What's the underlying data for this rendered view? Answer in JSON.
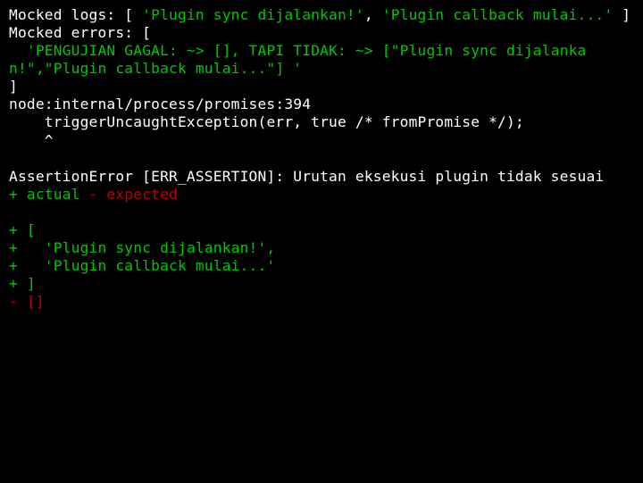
{
  "line1a": "Mocked logs: [ ",
  "line1b": "'Plugin sync dijalankan!'",
  "line1c": ", ",
  "line1d": "'Plugin callback mulai...'",
  "line1e": " ]",
  "line2": "Mocked errors: [",
  "line3": "  'PENGUJIAN GAGAL: ~> [], TAPI TIDAK: ~> [\"Plugin sync dijalankan!\",\"Plugin callback mulai...\"] '",
  "line4": "]",
  "line5": "node:internal/process/promises:394",
  "line6": "    triggerUncaughtException(err, true /* fromPromise */);",
  "line7": "    ^",
  "line8": "",
  "line9": "AssertionError [ERR_ASSERTION]: Urutan eksekusi plugin tidak sesuai",
  "line10a": "+ actual",
  "line10b": " ",
  "line10c": "- expected",
  "line11": "",
  "line12": "+ [",
  "line13": "+   'Plugin sync dijalankan!',",
  "line14": "+   'Plugin callback mulai...'",
  "line15": "+ ]",
  "line16": "- []"
}
